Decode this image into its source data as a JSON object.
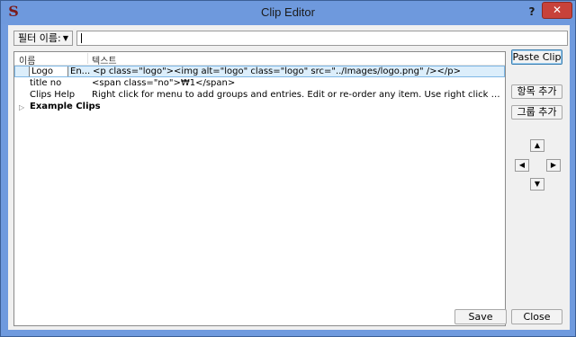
{
  "window": {
    "title": "Clip Editor",
    "help_label": "?",
    "close_label": "✕"
  },
  "filter": {
    "dropdown_label": "필터 이름:",
    "value": ""
  },
  "list": {
    "columns": [
      "이름",
      "텍스트"
    ],
    "rows": [
      {
        "name": "Logo",
        "name_suffix": "En...",
        "text": "<p class=\"logo\"><img alt=\"logo\" class=\"logo\" src=\"../Images/logo.png\" /></p>"
      },
      {
        "name": "title no",
        "text": "<span class=\"no\">₩1</span>"
      },
      {
        "name": "Clips Help",
        "text": "Right click for menu to add groups and entries.  Edit or re-order any item.   Use right click in editor to sel..."
      }
    ],
    "group": {
      "name": "Example Clips"
    }
  },
  "buttons": {
    "paste_clip": "Paste Clip",
    "add_entry": "항목 추가",
    "add_group": "그룹 추가",
    "save": "Save",
    "close": "Close"
  }
}
